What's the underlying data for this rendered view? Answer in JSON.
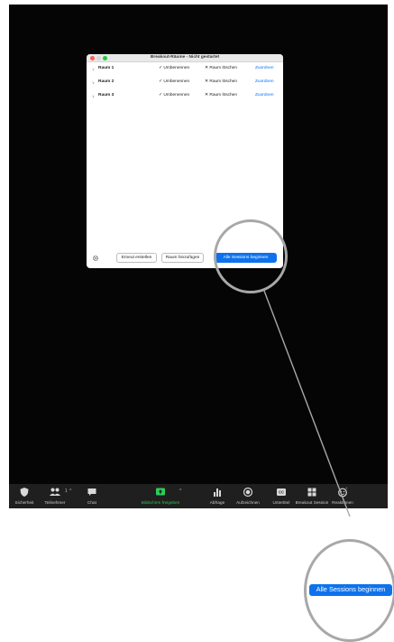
{
  "dialog": {
    "title": "Breakout-Räume - Nicht gestartet",
    "rooms": [
      {
        "name": "Raum 1",
        "rename": "Umbenennen",
        "delete": "Raum löschen",
        "assign": "Zuordnen"
      },
      {
        "name": "Raum 2",
        "rename": "Umbenennen",
        "delete": "Raum löschen",
        "assign": "Zuordnen"
      },
      {
        "name": "Raum 3",
        "rename": "Umbenennen",
        "delete": "Raum löschen",
        "assign": "Zuordnen"
      }
    ],
    "recreate_label": "Erneut erstellen",
    "add_room_label": "Raum hinzufügen",
    "start_label": "Alle Sessions beginnen"
  },
  "toolbar": {
    "items": [
      {
        "label": "Sicherheit",
        "icon": "shield-icon"
      },
      {
        "label": "Teilnehmer",
        "icon": "participants-icon",
        "count": "1"
      },
      {
        "label": "Chat",
        "icon": "chat-icon"
      },
      {
        "label": "Bildschirm freigeben",
        "icon": "share-screen-icon"
      },
      {
        "label": "Abfrage",
        "icon": "poll-icon"
      },
      {
        "label": "Aufzeichnen",
        "icon": "record-icon"
      },
      {
        "label": "Untertitel",
        "icon": "cc-icon"
      },
      {
        "label": "Breakout Session",
        "icon": "breakout-icon"
      },
      {
        "label": "Reaktionen",
        "icon": "reactions-icon"
      }
    ]
  },
  "zoom_callout": {
    "label": "Alle Sessions beginnen"
  },
  "colors": {
    "accent": "#0e72ed",
    "share_green": "#2dcb57",
    "delete_red": "#e0443a",
    "highlight_ring": "#a8a8a8"
  }
}
